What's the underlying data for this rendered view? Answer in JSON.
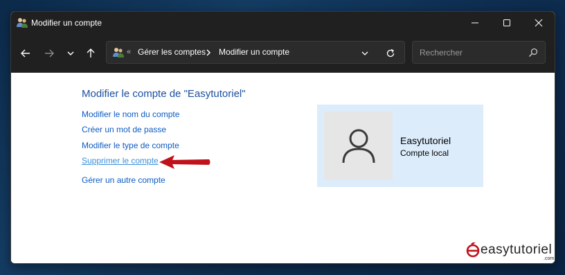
{
  "window": {
    "title": "Modifier un compte"
  },
  "address_bar": {
    "separator": "«",
    "breadcrumbs": [
      "Gérer les comptes",
      "Modifier un compte"
    ]
  },
  "search": {
    "placeholder": "Rechercher"
  },
  "main": {
    "heading": "Modifier le compte de \"Easytutoriel\"",
    "links": [
      "Modifier le nom du compte",
      "Créer un mot de passe",
      "Modifier le type de compte",
      "Supprimer le compte",
      "Gérer un autre compte"
    ],
    "active_link_index": 3
  },
  "account": {
    "name": "Easytutoriel",
    "type": "Compte local"
  },
  "watermark": {
    "text": "easytutoriel",
    "suffix": ".com"
  },
  "colors": {
    "link": "#0c5bc2",
    "link_active": "#3b8fd9",
    "heading": "#1a4fa0",
    "card": "#dcecfb",
    "arrow": "#c0121b",
    "titlebar": "#202020"
  },
  "icons": {
    "title": "users-icon",
    "back": "arrow-left-icon",
    "forward": "arrow-right-icon",
    "recent": "chevron-down-icon",
    "up": "arrow-up-icon",
    "refresh": "refresh-icon",
    "search": "search-icon",
    "avatar": "user-icon"
  }
}
